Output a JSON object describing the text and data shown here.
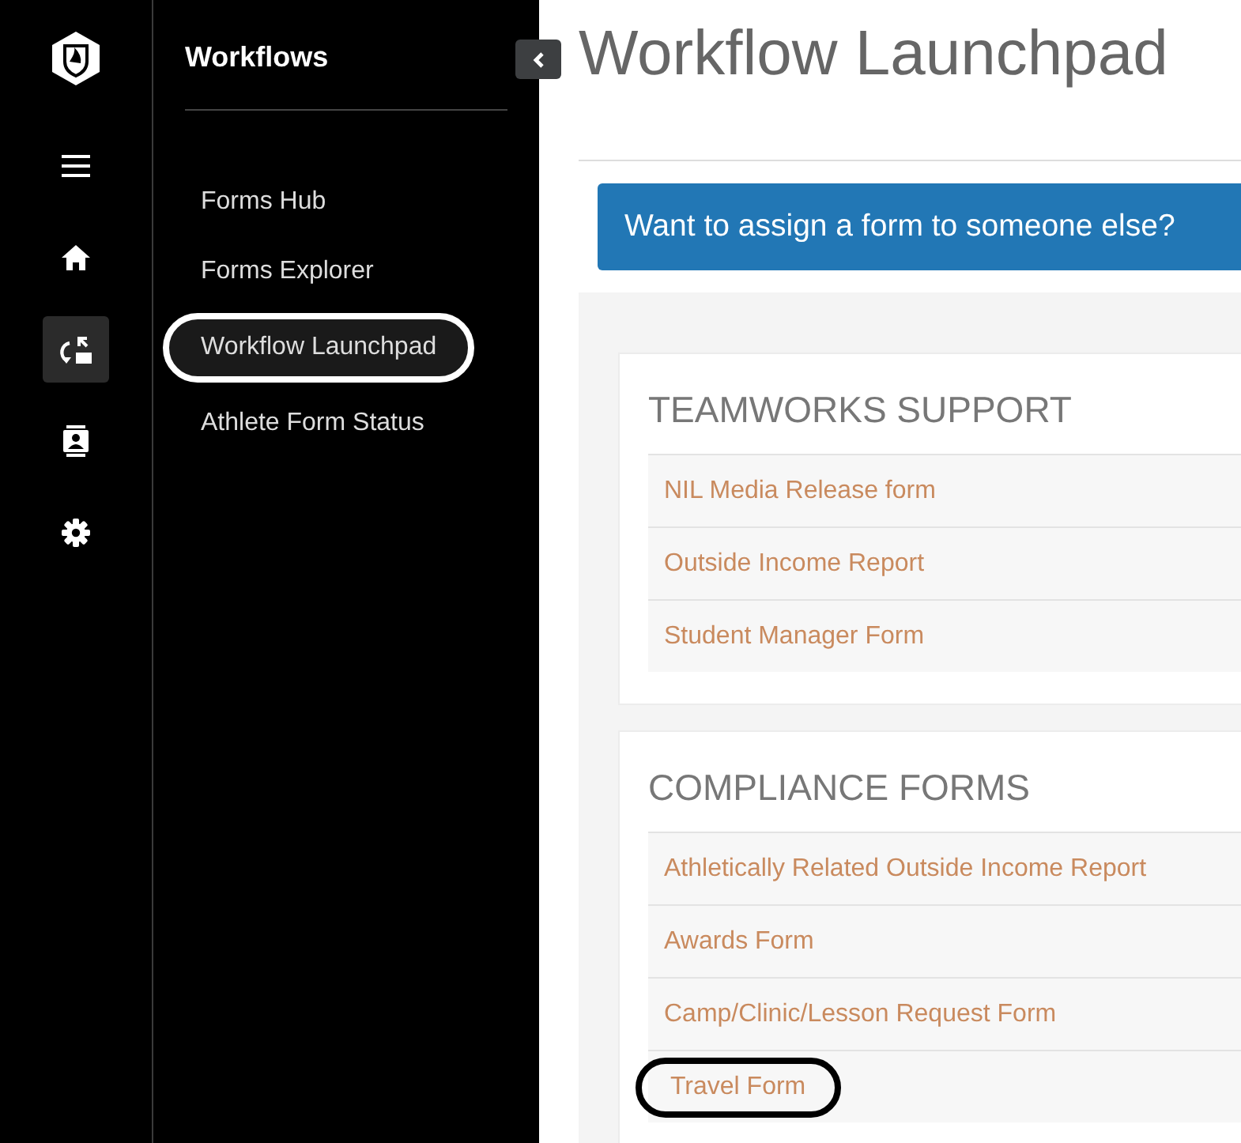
{
  "rail": {
    "items": [
      {
        "kind": "menu",
        "selected": false
      },
      {
        "kind": "home",
        "selected": false
      },
      {
        "kind": "workflow",
        "selected": true
      },
      {
        "kind": "contact",
        "selected": false
      },
      {
        "kind": "settings",
        "selected": false
      }
    ]
  },
  "sidebar": {
    "title": "Workflows",
    "items": [
      {
        "label": "Forms Hub",
        "circled": false
      },
      {
        "label": "Forms Explorer",
        "circled": false
      },
      {
        "label": "Workflow Launchpad",
        "circled": true
      },
      {
        "label": "Athlete Form Status",
        "circled": false
      }
    ]
  },
  "page": {
    "title": "Workflow Launchpad",
    "banner": "Want to assign a form to someone else?"
  },
  "sections": [
    {
      "title": "TEAMWORKS SUPPORT",
      "forms": [
        {
          "label": "NIL Media Release form",
          "circled": false
        },
        {
          "label": "Outside Income Report",
          "circled": false
        },
        {
          "label": "Student Manager Form",
          "circled": false
        }
      ]
    },
    {
      "title": "COMPLIANCE FORMS",
      "forms": [
        {
          "label": "Athletically Related Outside Income Report",
          "circled": false
        },
        {
          "label": "Awards Form",
          "circled": false
        },
        {
          "label": "Camp/Clinic/Lesson Request Form",
          "circled": false
        },
        {
          "label": "Travel Form",
          "circled": true
        }
      ]
    }
  ]
}
